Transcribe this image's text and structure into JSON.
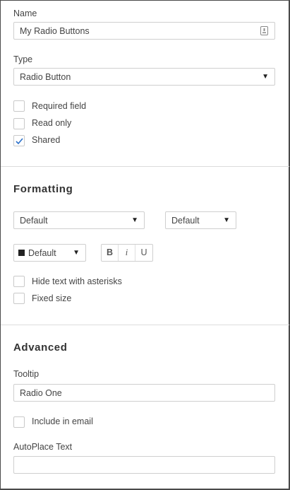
{
  "name": {
    "label": "Name",
    "value": "My Radio Buttons"
  },
  "type": {
    "label": "Type",
    "value": "Radio Button"
  },
  "options": [
    {
      "label": "Required field",
      "checked": false
    },
    {
      "label": "Read only",
      "checked": false
    },
    {
      "label": "Shared",
      "checked": true
    }
  ],
  "formatting": {
    "title": "Formatting",
    "font": "Default",
    "size": "Default",
    "color": "Default",
    "bold": "B",
    "italic": "i",
    "underline": "U",
    "hide_text": "Hide text with asterisks",
    "fixed_size": "Fixed size"
  },
  "advanced": {
    "title": "Advanced",
    "tooltip_label": "Tooltip",
    "tooltip_value": "Radio One",
    "include_email": "Include in email",
    "autoplace_label": "AutoPlace Text",
    "autoplace_value": ""
  },
  "colors": {
    "check": "#2a6fc9",
    "border": "#cfcfcf",
    "swatch": "#222222"
  },
  "icons": {
    "name_field": "text-field-icon",
    "dropdown": "caret-down-icon",
    "checked": "checkmark-icon"
  }
}
